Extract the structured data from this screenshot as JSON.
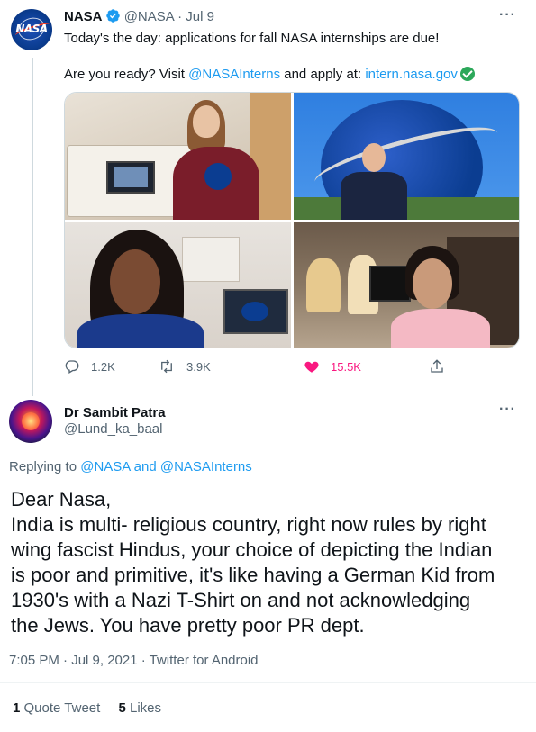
{
  "tweet1": {
    "name": "NASA",
    "handle": "@NASA",
    "separator": "·",
    "date": "Jul 9",
    "text_line1": "Today's the day: applications for fall NASA internships are due!",
    "text_line2_prefix": "Are you ready? Visit ",
    "mention": "@NASAInterns",
    "text_line2_mid": " and apply at: ",
    "link": "intern.nasa.gov",
    "reply_count": "1.2K",
    "retweet_count": "3.9K",
    "like_count": "15.5K"
  },
  "tweet2": {
    "name": "Dr Sambit Patra",
    "handle": "@Lund_ka_baal",
    "replying_prefix": "Replying to ",
    "replying_to_1": "@NASA",
    "replying_and": " and ",
    "replying_to_2": "@NASAInterns",
    "body_lines": [
      "Dear Nasa,",
      "India is multi- religious country, right now rules by right",
      "wing fascist Hindus, your choice of depicting the Indian",
      "is poor and primitive, it's like having a German Kid from",
      "1930's with a Nazi T-Shirt on and not acknowledging",
      "the Jews. You have pretty poor PR dept."
    ],
    "meta": "7:05 PM · Jul 9, 2021 · Twitter for Android",
    "quote_count": "1",
    "quote_label": "Quote Tweet",
    "like_count": "5",
    "like_label": "Likes"
  },
  "colors": {
    "link": "#1d9bf0",
    "muted": "#536471",
    "like": "#f91880",
    "verified": "#1d9bf0"
  },
  "icons": [
    "more-icon",
    "verified-icon",
    "check-emoji-icon",
    "reply-icon",
    "retweet-icon",
    "heart-icon",
    "share-icon"
  ]
}
